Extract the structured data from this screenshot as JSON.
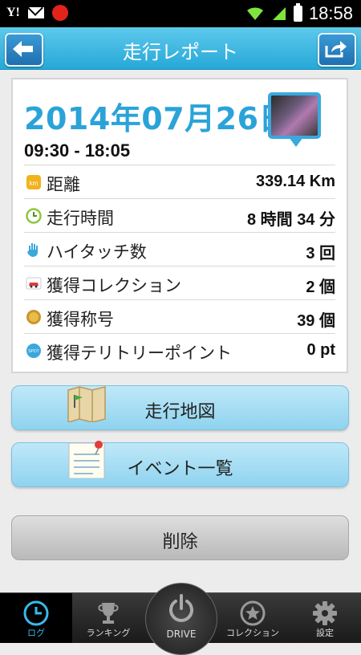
{
  "status_bar": {
    "time": "18:58"
  },
  "header": {
    "title": "走行レポート"
  },
  "report": {
    "date": "2014年07月26日",
    "time_range": "09:30 - 18:05",
    "rows": [
      {
        "label": "距離",
        "value": "339.14 Km"
      },
      {
        "label": "走行時間",
        "value": "8 時間 34 分"
      },
      {
        "label": "ハイタッチ数",
        "value": "3 回"
      },
      {
        "label": "獲得コレクション",
        "value": "2 個"
      },
      {
        "label": "獲得称号",
        "value": "39 個"
      },
      {
        "label": "獲得テリトリーポイント",
        "value": "0 pt"
      }
    ],
    "icon_texts": {
      "km": "km",
      "spot": "SPOT"
    }
  },
  "buttons": {
    "map": "走行地図",
    "events": "イベント一覧",
    "delete": "削除"
  },
  "tabs": {
    "log": "ログ",
    "ranking": "ランキング",
    "drive": "DRIVE",
    "collection": "コレクション",
    "settings": "設定"
  },
  "colors": {
    "accent": "#2aa3d8",
    "header": "#26a8d8",
    "active_tab": "#3ab8ec"
  }
}
